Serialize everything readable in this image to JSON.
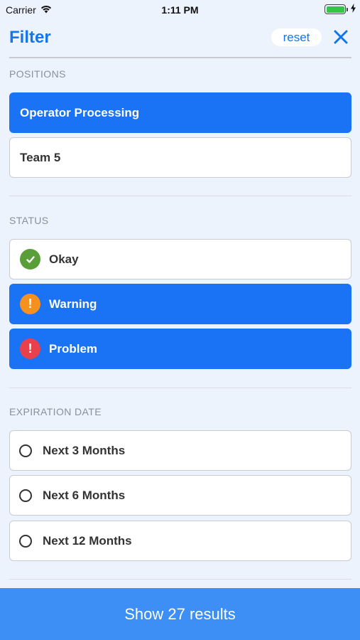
{
  "status_bar": {
    "carrier": "Carrier",
    "time": "1:11 PM",
    "battery_level": 1.0
  },
  "header": {
    "title": "Filter",
    "reset_label": "reset",
    "close_icon": "close-icon"
  },
  "sections": {
    "positions": {
      "label": "POSITIONS",
      "options": [
        {
          "label": "Operator Processing",
          "selected": true
        },
        {
          "label": "Team 5",
          "selected": false
        }
      ]
    },
    "status": {
      "label": "STATUS",
      "options": [
        {
          "label": "Okay",
          "selected": false,
          "icon": "check-icon",
          "icon_color": "#5A9E3A",
          "glyph": "✓"
        },
        {
          "label": "Warning",
          "selected": true,
          "icon": "warning-icon",
          "icon_color": "#F5911E",
          "glyph": "!"
        },
        {
          "label": "Problem",
          "selected": true,
          "icon": "error-icon",
          "icon_color": "#E8414B",
          "glyph": "!"
        }
      ]
    },
    "expiration": {
      "label": "EXPIRATION DATE",
      "options": [
        {
          "label": "Next 3 Months",
          "selected": false
        },
        {
          "label": "Next 6 Months",
          "selected": false
        },
        {
          "label": "Next 12 Months",
          "selected": false
        }
      ]
    }
  },
  "footer": {
    "results_label": "Show 27 results"
  },
  "colors": {
    "accent": "#1277EE",
    "selected_bg": "#1A73F4",
    "footer_bg": "#3D8EF5",
    "page_bg": "#ECF3FD"
  }
}
